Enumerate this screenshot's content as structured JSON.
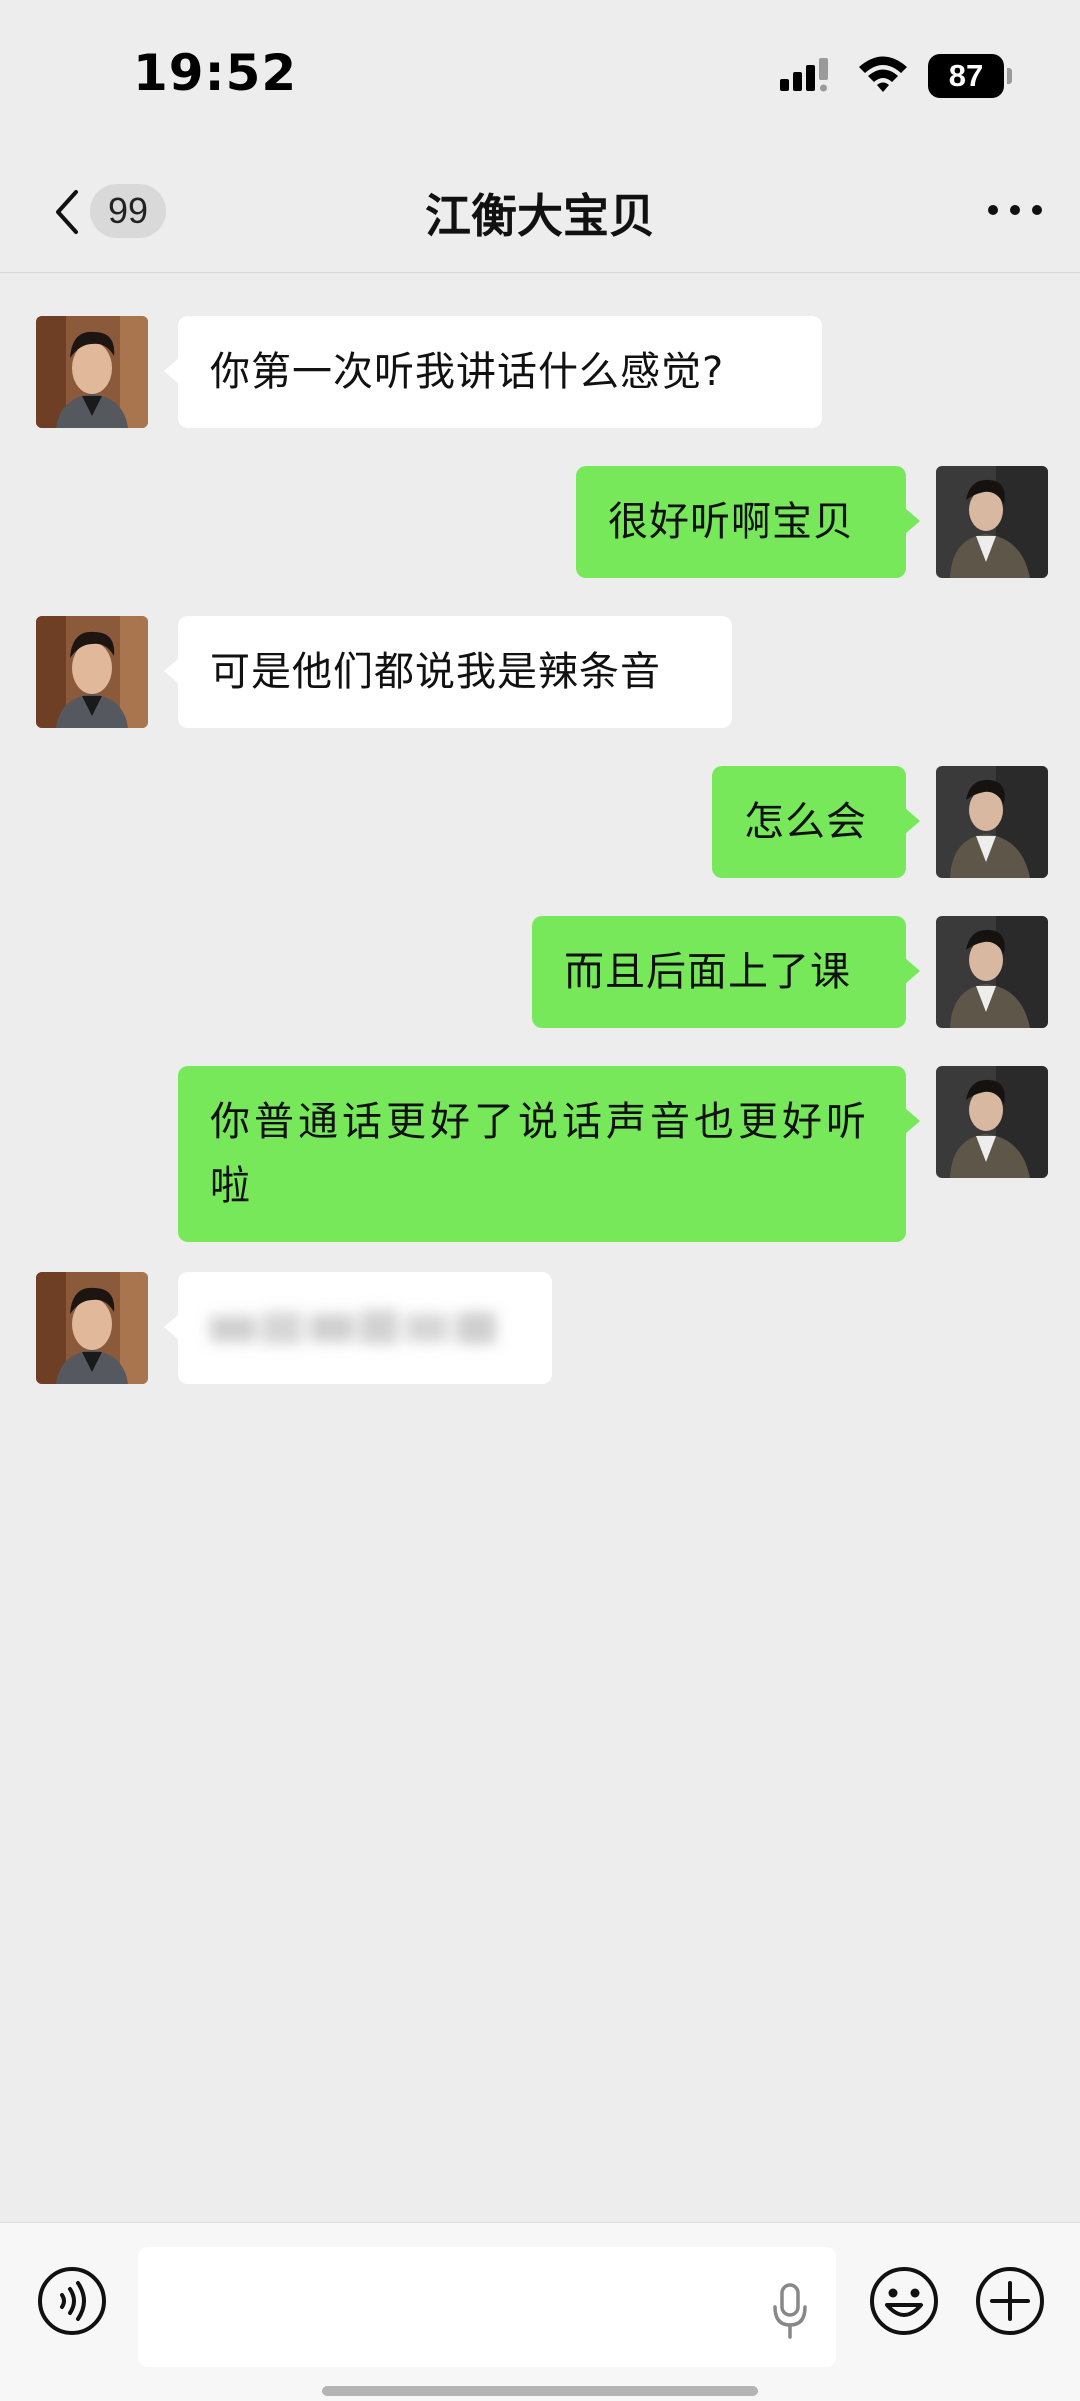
{
  "status_bar": {
    "time": "19:52",
    "battery": "87",
    "icons": [
      "signal-icon",
      "wifi-icon",
      "battery-icon"
    ]
  },
  "header": {
    "back_badge": "99",
    "title": "江衡大宝贝",
    "icons": [
      "chevron-left-icon",
      "more-icon"
    ]
  },
  "messages": [
    {
      "side": "left",
      "text": "你第一次听我讲话什么感觉?"
    },
    {
      "side": "right",
      "text": "很好听啊宝贝"
    },
    {
      "side": "left",
      "text": "可是他们都说我是辣条音"
    },
    {
      "side": "right",
      "text": "怎么会"
    },
    {
      "side": "right",
      "text": "而且后面上了课"
    },
    {
      "side": "right",
      "text": "你普通话更好了说话声音也更好听啦"
    },
    {
      "side": "left",
      "text": "",
      "blurred": true
    }
  ],
  "input_bar": {
    "placeholder": "",
    "icons": [
      "voice-icon",
      "mic-icon",
      "emoji-icon",
      "plus-icon"
    ]
  },
  "colors": {
    "background": "#ededed",
    "bubble_self": "#77e85a",
    "bubble_other": "#ffffff"
  }
}
